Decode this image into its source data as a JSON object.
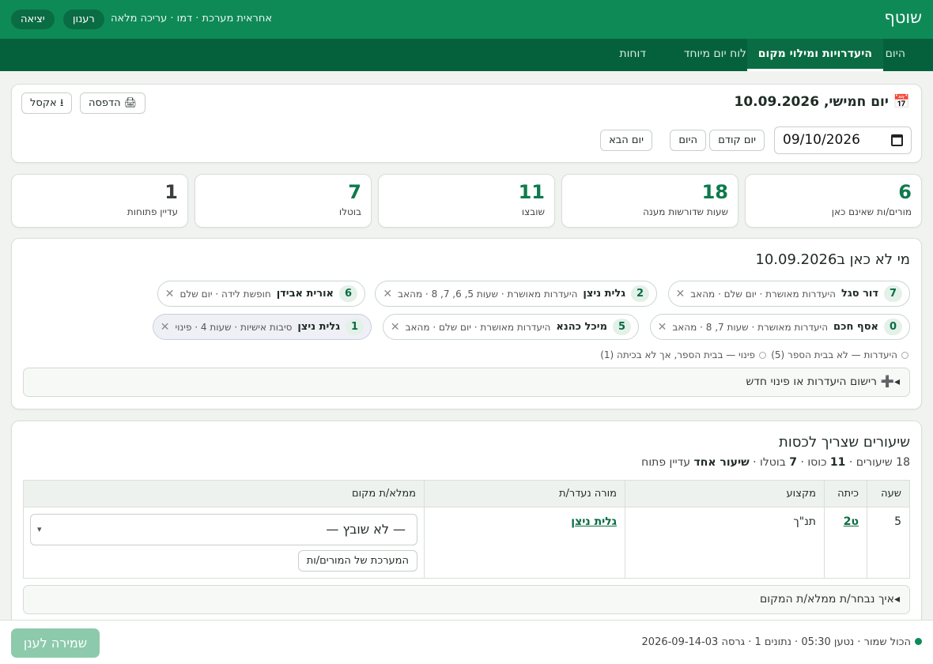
{
  "app": {
    "brand": "שוטף",
    "user_info": "אחראית מערכת · דמו · עריכה מלאה",
    "refresh_label": "רענון",
    "logout_label": "יציאה"
  },
  "nav": {
    "tabs": [
      {
        "label": "היום"
      },
      {
        "label": "היעדרויות ומילוי מקום"
      },
      {
        "label": "לוח יום מיוחד"
      },
      {
        "label": "דוחות"
      }
    ],
    "active_index": 1
  },
  "date_card": {
    "title": "📅 יום חמישי, 10.09.2026",
    "print_label": "🖨 הדפסה",
    "excel_label": "⭳ אקסל",
    "date_value": "09/10/2026",
    "prev_day": "יום קודם",
    "today": "היום",
    "next_day": "יום הבא"
  },
  "stats": [
    {
      "value": "6",
      "label": "מורים/ות שאינם כאן"
    },
    {
      "value": "18",
      "label": "שעות שדורשות מענה"
    },
    {
      "value": "11",
      "label": "שובצו"
    },
    {
      "value": "7",
      "label": "בוטלו"
    },
    {
      "value": "1",
      "label": "עדיין פתוחות"
    }
  ],
  "absent": {
    "title": "מי לא כאן ב10.09.2026",
    "chips": [
      {
        "count": "7",
        "name": "דור סגל",
        "detail": "היעדרות מאושרת · יום שלם · מהאב"
      },
      {
        "count": "2",
        "name": "גלית ניצן",
        "detail": "היעדרות מאושרת · שעות 5, 6, 7, 8 · מהאב"
      },
      {
        "count": "6",
        "name": "אורית אבידן",
        "detail": "חופשת לידה · יום שלם"
      },
      {
        "count": "0",
        "name": "אסף חכם",
        "detail": "היעדרות מאושרת · שעות 7, 8 · מהאב"
      },
      {
        "count": "5",
        "name": "מיכל כהנא",
        "detail": "היעדרות מאושרת · יום שלם · מהאב"
      },
      {
        "count": "1",
        "name": "גלית ניצן",
        "detail": "סיבות אישיות · שעות 4 · פינוי"
      }
    ],
    "legend_absence": "היעדרות — לא בבית הספר (5)",
    "legend_release": "פינוי — בבית הספר, אך לא בכיתה (1)",
    "add_label": "➕ רישום היעדרות או פינוי חדש"
  },
  "lessons": {
    "title": "שיעורים שצריך לכסות",
    "summary_total": "18 שיעורים · ",
    "summary_covered_num": "11",
    "summary_covered_text": " כוסו · ",
    "summary_cancel_num": "7",
    "summary_cancel_text": " בוטלו · ",
    "summary_open_bold": "שיעור אחד",
    "summary_open_text": " עדיין פתוח",
    "columns": [
      "שעה",
      "כיתה",
      "מקצוע",
      "מורה נעדר/ת",
      "ממלא/ת מקום"
    ],
    "rows": [
      {
        "hour": "5",
        "class": "ט2",
        "subject": "תנ\"ך",
        "teacher": "גלית ניצן",
        "substitute": "— לא שובץ —",
        "system_btn": "המערכת של המורים/ות"
      }
    ],
    "how_chosen": "איך נבחר/ת ממלא/ת המקום"
  },
  "footer": {
    "status": "הכול שמור · נטען 05:30 · נתונים 1 · גרסה 2026-09-14-03",
    "save_label": "שמירה לענן"
  },
  "colors": {
    "primary": "#0e8a57",
    "nav": "#05613b",
    "accent_text": "#0e7a4d"
  }
}
